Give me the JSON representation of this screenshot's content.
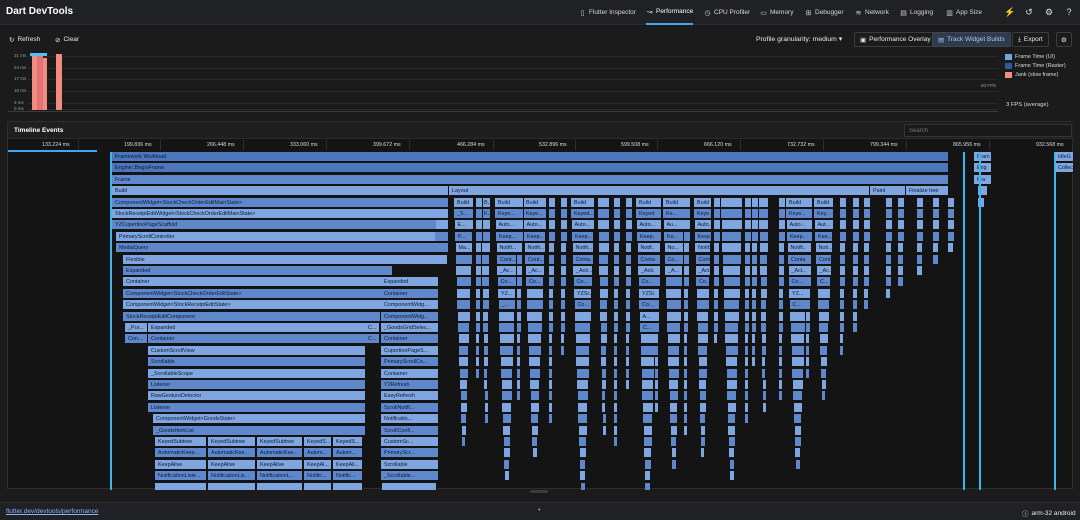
{
  "app": {
    "title": "Dart DevTools"
  },
  "nav": {
    "tabs": [
      {
        "label": "Flutter Inspector",
        "icon": "inspector-icon",
        "glyph": "▯"
      },
      {
        "label": "Performance",
        "icon": "performance-icon",
        "glyph": "↝",
        "active": true
      },
      {
        "label": "CPU Profiler",
        "icon": "cpu-icon",
        "glyph": "◷"
      },
      {
        "label": "Memory",
        "icon": "memory-icon",
        "glyph": "▭"
      },
      {
        "label": "Debugger",
        "icon": "debugger-icon",
        "glyph": "⊞"
      },
      {
        "label": "Network",
        "icon": "network-icon",
        "glyph": "≋"
      },
      {
        "label": "Logging",
        "icon": "logging-icon",
        "glyph": "▤"
      },
      {
        "label": "App Size",
        "icon": "app-size-icon",
        "glyph": "▥"
      }
    ],
    "right_icons": [
      "lightning-icon",
      "history-icon",
      "settings-icon",
      "help-icon"
    ]
  },
  "toolbar": {
    "refresh": "Refresh",
    "clear": "Clear",
    "granularity": "Profile granularity: medium",
    "performance_overlay": "Performance Overlay",
    "track_widget_builds": "Track Widget Builds",
    "export": "Export"
  },
  "frames_chart": {
    "y_ticks": [
      "31 ms",
      "24 ms",
      "17 ms",
      "10 ms",
      "3 ms",
      "0 ms"
    ],
    "fps_marker": "60 FPS",
    "legend": [
      {
        "label": "Frame Time (UI)",
        "color": "#6fa8dc"
      },
      {
        "label": "Frame Time (Raster)",
        "color": "#2e5a9c"
      },
      {
        "label": "Jank (slow frame)",
        "color": "#f28b82"
      }
    ],
    "average": "3 FPS (average)"
  },
  "timeline": {
    "title": "Timeline Events",
    "search_placeholder": "Search",
    "ticks": [
      "133.224 ms",
      "199.836 ms",
      "266.448 ms",
      "333.060 ms",
      "399.672 ms",
      "466.284 ms",
      "532.896 ms",
      "599.508 ms",
      "666.120 ms",
      "732.732 ms",
      "799.344 ms",
      "865.956 ms",
      "932.568 ms"
    ]
  },
  "flame": {
    "main_labels": {
      "framework": "Framework Workload",
      "engine": "Engine::BeginFrame",
      "frame": "Frame",
      "build": "Build",
      "layout": "Layout",
      "paint": "Paint",
      "finalize": "Finalize tree",
      "right1": "Fram",
      "right2": "Eng",
      "right3": "Fra",
      "idle": "IdleG",
      "collect": "Collec"
    },
    "left_stack": [
      "ComponentWidget<StockCheckOrderEditMainState>",
      "StockReceiptEditWidget<StockCheckOrderEditMainState>",
      "YZCupertinoPageScaffold",
      "PrimaryScrollController",
      "MediaQuery",
      "Flexible",
      "Expanded",
      "Container",
      "ComponentWidget<StockCheckOrderEditState>",
      "ComponentWidget<StockReceiptEditState>",
      "StockReceiptEditComponent"
    ],
    "inner_a": [
      "_Pur...",
      "Con..."
    ],
    "inner_b": [
      "Expanded",
      "Container",
      "CustomScrollView",
      "Scrollable",
      "_ScrollableScope",
      "Listener",
      "RawGestureDetector",
      "Listener"
    ],
    "inner_c": [
      "ComponentWidget<GoodsState>",
      "_GoodsItemList"
    ],
    "leaf_cols": [
      [
        "KeyedSubtree",
        "AutomaticKeep...",
        "KeepAlive",
        "NotificationListe..."
      ],
      [
        "KeyedSubtree",
        "AutomaticKee...",
        "KeepAlive",
        "NotificationLis..."
      ],
      [
        "KeyedSubtree",
        "AutomaticKee...",
        "KeepAlive",
        "NotificationL..."
      ],
      [
        "KeyedS...",
        "Autom...",
        "KeepAl...",
        "Notific..."
      ],
      [
        "KeyedS...",
        "Autom...",
        "KeepAli...",
        "Notific..."
      ]
    ],
    "mid_stack": [
      "Expanded",
      "Container",
      "ComponentWidg...",
      "ComponentWidg...",
      "_GoodsGridSelec...",
      "Container",
      "CupertinoPageS...",
      "PrimaryScrollCo...",
      "Container",
      "Y2Refresh",
      "EasyRefresh",
      "ScrollNotifi...",
      "Notificatio...",
      "ScrollConfi...",
      "CustomSc...",
      "PrimaryScr...",
      "Scrollable",
      "_Scrollable..."
    ],
    "small_c": [
      "C...",
      "C..."
    ],
    "spike_labels": [
      [
        "Build",
        "_S...",
        "E...",
        "P...",
        "Ma..."
      ],
      [
        "B...",
        "K..."
      ],
      [
        "Build",
        "Keye...",
        "Auto...",
        "Keep...",
        "Notifi...",
        "Cont...",
        "_Ac...",
        "Co...",
        "YZ...",
        "_..."
      ],
      [
        "Build",
        "Keye...",
        "Auto...",
        "Keep...",
        "Notifi...",
        "Cont...",
        "_Ac...",
        "Co..."
      ],
      [
        "Build",
        "Keyed...",
        "Auto...",
        "Keep...",
        "Notifi...",
        "Conta...",
        "_Acti...",
        "Co...",
        "YZSi...",
        "Co..."
      ],
      [
        "Build",
        "Keyed...",
        "Auto...",
        "Keep...",
        "Notif...",
        "Conta...",
        "_Acti...",
        "Co...",
        "YZSl...",
        "Co...",
        "A...",
        "C..."
      ],
      [
        "Build",
        "Ke...",
        "Au...",
        "Ke...",
        "No...",
        "Co...",
        "_A..."
      ],
      [
        "Build",
        "Keye...",
        "Auto...",
        "Keep...",
        "Notif...",
        "Conta...",
        "_Act...",
        "Co..."
      ],
      [
        "Build",
        "Keye...",
        "Auto...",
        "Keep...",
        "Notifi...",
        "Conta...",
        "_Act...",
        "Co...",
        "YZ...",
        "C..."
      ],
      [
        "Build",
        "Key...",
        "Aut...",
        "Kee...",
        "Noti...",
        "Cont...",
        "_Ac...",
        "C..."
      ]
    ]
  },
  "status": {
    "link": "flutter.dev/devtools/performance",
    "dot": "•",
    "device": "arm-32 android"
  }
}
